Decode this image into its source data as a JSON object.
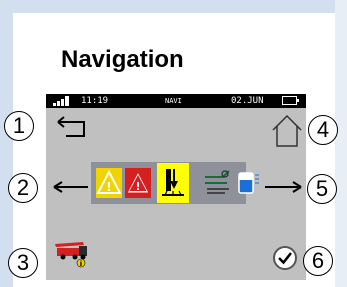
{
  "title": "Navigation",
  "status_bar": {
    "time": "11:19",
    "mode": "NAVI",
    "date": "02.JUN"
  },
  "callouts": [
    "1",
    "2",
    "3",
    "4",
    "5",
    "6"
  ],
  "icons": {
    "back": "return-arrow-icon",
    "home": "home-icon",
    "prev": "left-arrow-icon",
    "next": "right-arrow-icon",
    "warning_yellow": "yellow-warning-icon",
    "warning_red": "red-warning-icon",
    "machine": "machine-icon",
    "info_machine": "concrete-pump-truck-info-icon",
    "confirm": "checkmark-icon"
  },
  "colors": {
    "screen": "#c0c0c0",
    "selected": "#ffff00",
    "warning_yellow": "#f0d400",
    "warning_red": "#d42020"
  }
}
